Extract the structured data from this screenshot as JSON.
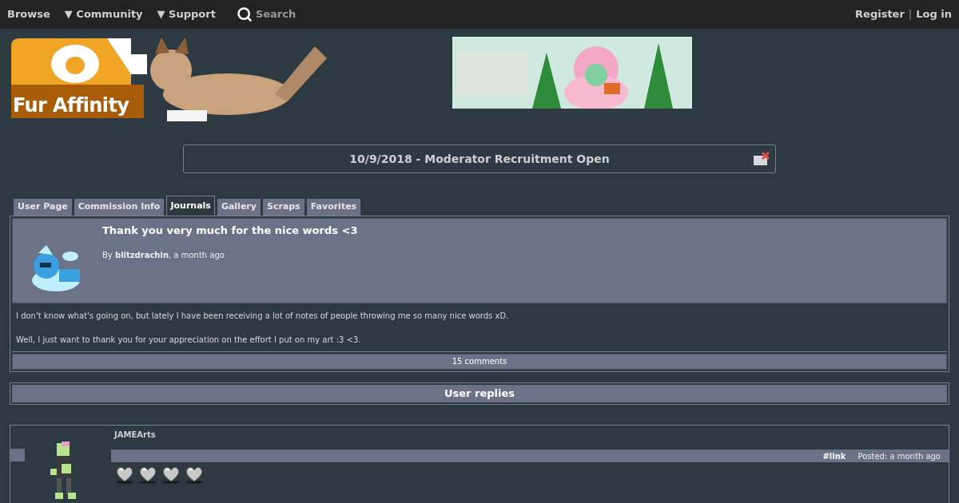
{
  "nav": {
    "left": [
      {
        "label": "Browse"
      },
      {
        "label": "▼ Community"
      },
      {
        "label": "▼ Support"
      }
    ],
    "search": {
      "placeholder": "Search"
    },
    "right": [
      {
        "label": "Register",
        "kind": "link"
      },
      {
        "label": "|",
        "kind": "separator"
      },
      {
        "label": "Log in",
        "kind": "link"
      }
    ]
  },
  "logo": {
    "text": "Fur Affinity"
  },
  "notice": {
    "text": "10/9/2018 - Moderator Recruitment Open"
  },
  "tabs": [
    {
      "label": "User Page",
      "selected": false
    },
    {
      "label": "Commission Info",
      "selected": false
    },
    {
      "label": "Journals",
      "selected": true
    },
    {
      "label": "Gallery",
      "selected": false
    },
    {
      "label": "Scraps",
      "selected": false
    },
    {
      "label": "Favorites",
      "selected": false
    }
  ],
  "journal": {
    "title": "Thank you very much for the nice words <3",
    "byline": "By **blitzdrachin**, a month ago",
    "paragraphs": [
      "I don't know what's going on, but lately I have been receiving a lot of notes of people throwing me so many nice words xD.",
      "Well, I just want to thank you for your appreciation on the effort I put on my art :3 <3."
    ],
    "comments": "15 comments"
  },
  "replies": {
    "heading": "User replies",
    "items": [
      {
        "user": "JAMEArts",
        "link": "#link",
        "posted": "Posted: a month ago"
      }
    ]
  }
}
